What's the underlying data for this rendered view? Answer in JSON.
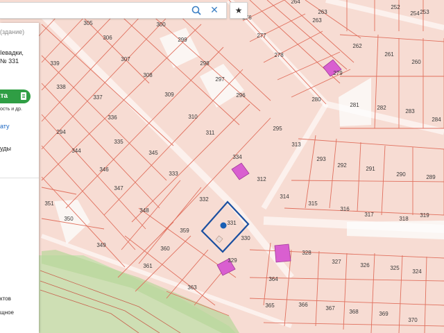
{
  "search": {
    "value": "",
    "placeholder": ""
  },
  "icons": {
    "search": "search-icon",
    "clear": "close-icon",
    "favorite": "star-icon"
  },
  "panel": {
    "type_label": "(здание)",
    "address_line1": "Іевадки,",
    "address_line2": "№ 331",
    "report_button": "екта",
    "report_sub": "ость и др.",
    "link_text": "ату",
    "text1": "уды",
    "text2": "ктов",
    "text3": "щное"
  },
  "map": {
    "colors": {
      "background": "#f7dcd3",
      "parcel_border": "#e0705e",
      "building": "#d95fd0",
      "selection": "#1a4fa0",
      "greenery": "#c9dfb0",
      "marker": "#1a5fb4"
    },
    "selected_parcel": "331",
    "parcel_labels": [
      "305",
      "300",
      "276",
      "264",
      "263",
      "254",
      "253",
      "252",
      "306",
      "299",
      "277",
      "263",
      "262",
      "261",
      "260",
      "339",
      "307",
      "298",
      "278",
      "279",
      "338",
      "308",
      "297",
      "296",
      "281",
      "280",
      "282",
      "283",
      "284",
      "337",
      "309",
      "310",
      "336",
      "335",
      "311",
      "295",
      "294",
      "344",
      "345",
      "334",
      "312",
      "313",
      "293",
      "292",
      "291",
      "290",
      "289",
      "346",
      "333",
      "347",
      "314",
      "315",
      "316",
      "317",
      "318",
      "319",
      "348",
      "332",
      "331",
      "351",
      "350",
      "359",
      "330",
      "349",
      "360",
      "329",
      "328",
      "327",
      "326",
      "325",
      "324",
      "361",
      "363",
      "364",
      "365",
      "366",
      "367",
      "368",
      "369",
      "370"
    ]
  }
}
